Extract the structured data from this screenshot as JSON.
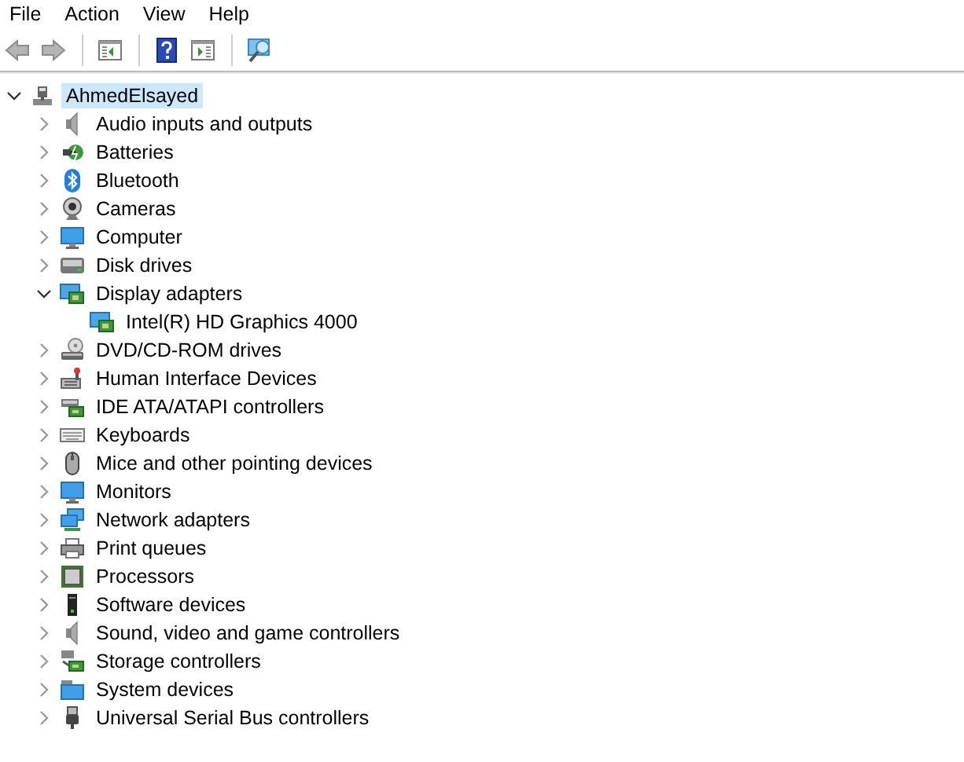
{
  "menu_bar": [
    {
      "label": "File"
    },
    {
      "label": "Action"
    },
    {
      "label": "View"
    },
    {
      "label": "Help"
    }
  ],
  "toolbar": [
    {
      "kind": "back",
      "disabled": true
    },
    {
      "kind": "forward",
      "disabled": true
    },
    {
      "kind": "sep"
    },
    {
      "kind": "tree-pane",
      "disabled": false
    },
    {
      "kind": "sep"
    },
    {
      "kind": "help",
      "disabled": false
    },
    {
      "kind": "action-pane",
      "disabled": false
    },
    {
      "kind": "sep"
    },
    {
      "kind": "scan",
      "disabled": false
    }
  ],
  "tree": {
    "label": "AhmedElsayed",
    "kind": "pc",
    "expanded": true,
    "selected": true,
    "children": [
      {
        "label": "Audio inputs and outputs",
        "kind": "audio",
        "expanded": false,
        "selected": false
      },
      {
        "label": "Batteries",
        "kind": "battery",
        "expanded": false,
        "selected": false
      },
      {
        "label": "Bluetooth",
        "kind": "bluetooth",
        "expanded": false,
        "selected": false
      },
      {
        "label": "Cameras",
        "kind": "camera",
        "expanded": false,
        "selected": false
      },
      {
        "label": "Computer",
        "kind": "monitor",
        "expanded": false,
        "selected": false
      },
      {
        "label": "Disk drives",
        "kind": "disk",
        "expanded": false,
        "selected": false
      },
      {
        "label": "Display adapters",
        "kind": "display",
        "expanded": true,
        "selected": false,
        "children": [
          {
            "label": "Intel(R) HD Graphics 4000",
            "kind": "display",
            "selected": false
          }
        ]
      },
      {
        "label": "DVD/CD-ROM drives",
        "kind": "dvd",
        "expanded": false,
        "selected": false
      },
      {
        "label": "Human Interface Devices",
        "kind": "hid",
        "expanded": false,
        "selected": false
      },
      {
        "label": "IDE ATA/ATAPI controllers",
        "kind": "ide",
        "expanded": false,
        "selected": false
      },
      {
        "label": "Keyboards",
        "kind": "keyboard",
        "expanded": false,
        "selected": false
      },
      {
        "label": "Mice and other pointing devices",
        "kind": "mouse",
        "expanded": false,
        "selected": false
      },
      {
        "label": "Monitors",
        "kind": "monitor",
        "expanded": false,
        "selected": false
      },
      {
        "label": "Network adapters",
        "kind": "network",
        "expanded": false,
        "selected": false
      },
      {
        "label": "Print queues",
        "kind": "printer",
        "expanded": false,
        "selected": false
      },
      {
        "label": "Processors",
        "kind": "processor",
        "expanded": false,
        "selected": false
      },
      {
        "label": "Software devices",
        "kind": "software",
        "expanded": false,
        "selected": false
      },
      {
        "label": "Sound, video and game controllers",
        "kind": "audio",
        "expanded": false,
        "selected": false
      },
      {
        "label": "Storage controllers",
        "kind": "storage",
        "expanded": false,
        "selected": false
      },
      {
        "label": "System devices",
        "kind": "system",
        "expanded": false,
        "selected": false
      },
      {
        "label": "Universal Serial Bus controllers",
        "kind": "usb",
        "expanded": false,
        "selected": false
      }
    ]
  }
}
